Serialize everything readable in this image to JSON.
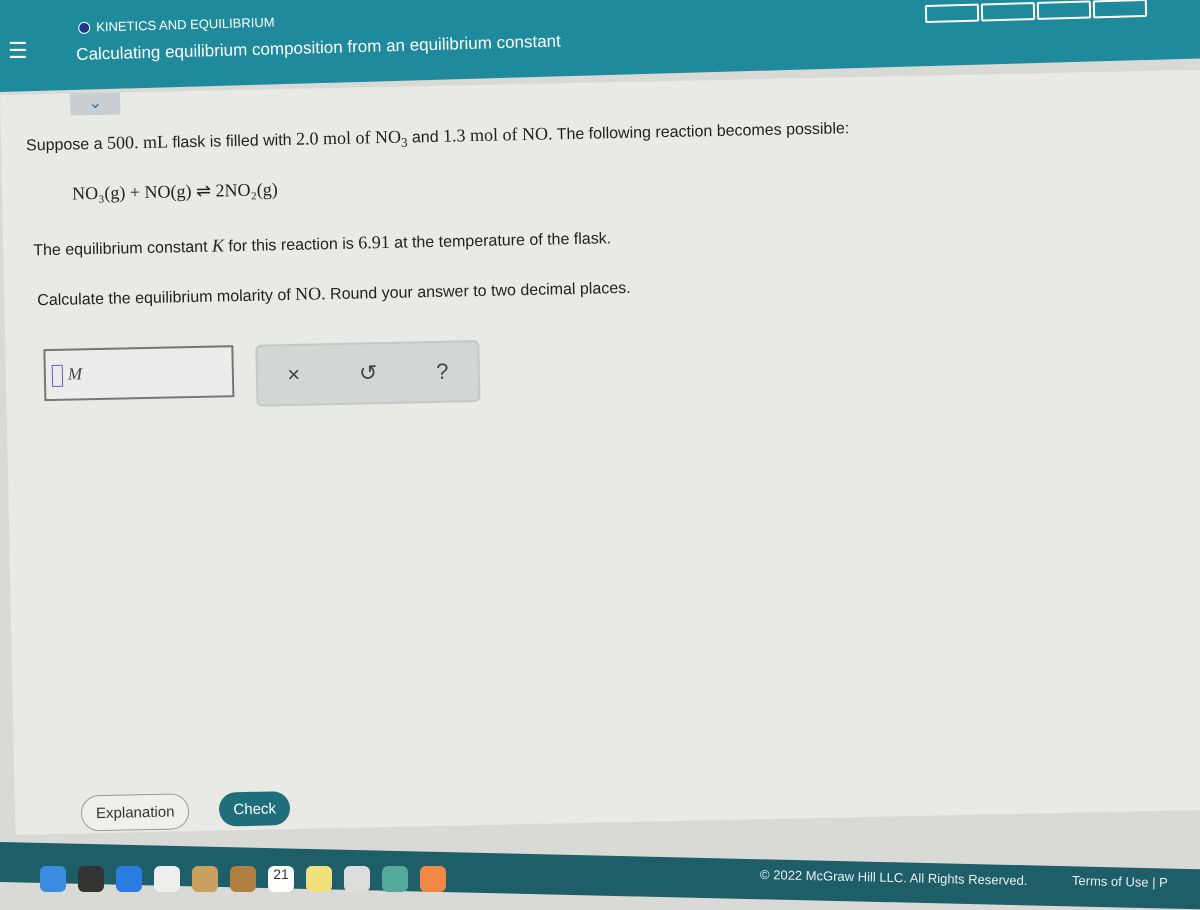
{
  "header": {
    "category": "KINETICS AND EQUILIBRIUM",
    "title": "Calculating equilibrium composition from an equilibrium constant"
  },
  "question": {
    "intro_pre": "Suppose a ",
    "volume": "500. mL",
    "intro_mid": " flask is filled with ",
    "amt1": "2.0 mol of NO",
    "sub1": "3",
    "intro_and": " and ",
    "amt2": "1.3 mol of NO.",
    "intro_post": " The following reaction becomes possible:",
    "reaction": "NO₃(g) + NO(g) ⇌ 2NO₂(g)",
    "k_pre": "The equilibrium constant ",
    "k_sym": "K",
    "k_mid": " for this reaction is ",
    "k_val": "6.91",
    "k_post": " at the temperature of the flask.",
    "task_pre": "Calculate the equilibrium molarity of ",
    "task_species": "NO.",
    "task_post": " Round your answer to two decimal places."
  },
  "answer": {
    "value": "",
    "unit": "M"
  },
  "tools": {
    "clear": "×",
    "undo": "↺",
    "help": "?"
  },
  "buttons": {
    "explanation": "Explanation",
    "check": "Check"
  },
  "footer": {
    "copyright": "© 2022 McGraw Hill LLC. All Rights Reserved.",
    "terms": "Terms of Use  |  P"
  },
  "dock": {
    "calendar_day": "21"
  },
  "colors": {
    "header": "#1f8a9c",
    "check_button": "#1f6e7c",
    "footer": "#1e5e68"
  }
}
